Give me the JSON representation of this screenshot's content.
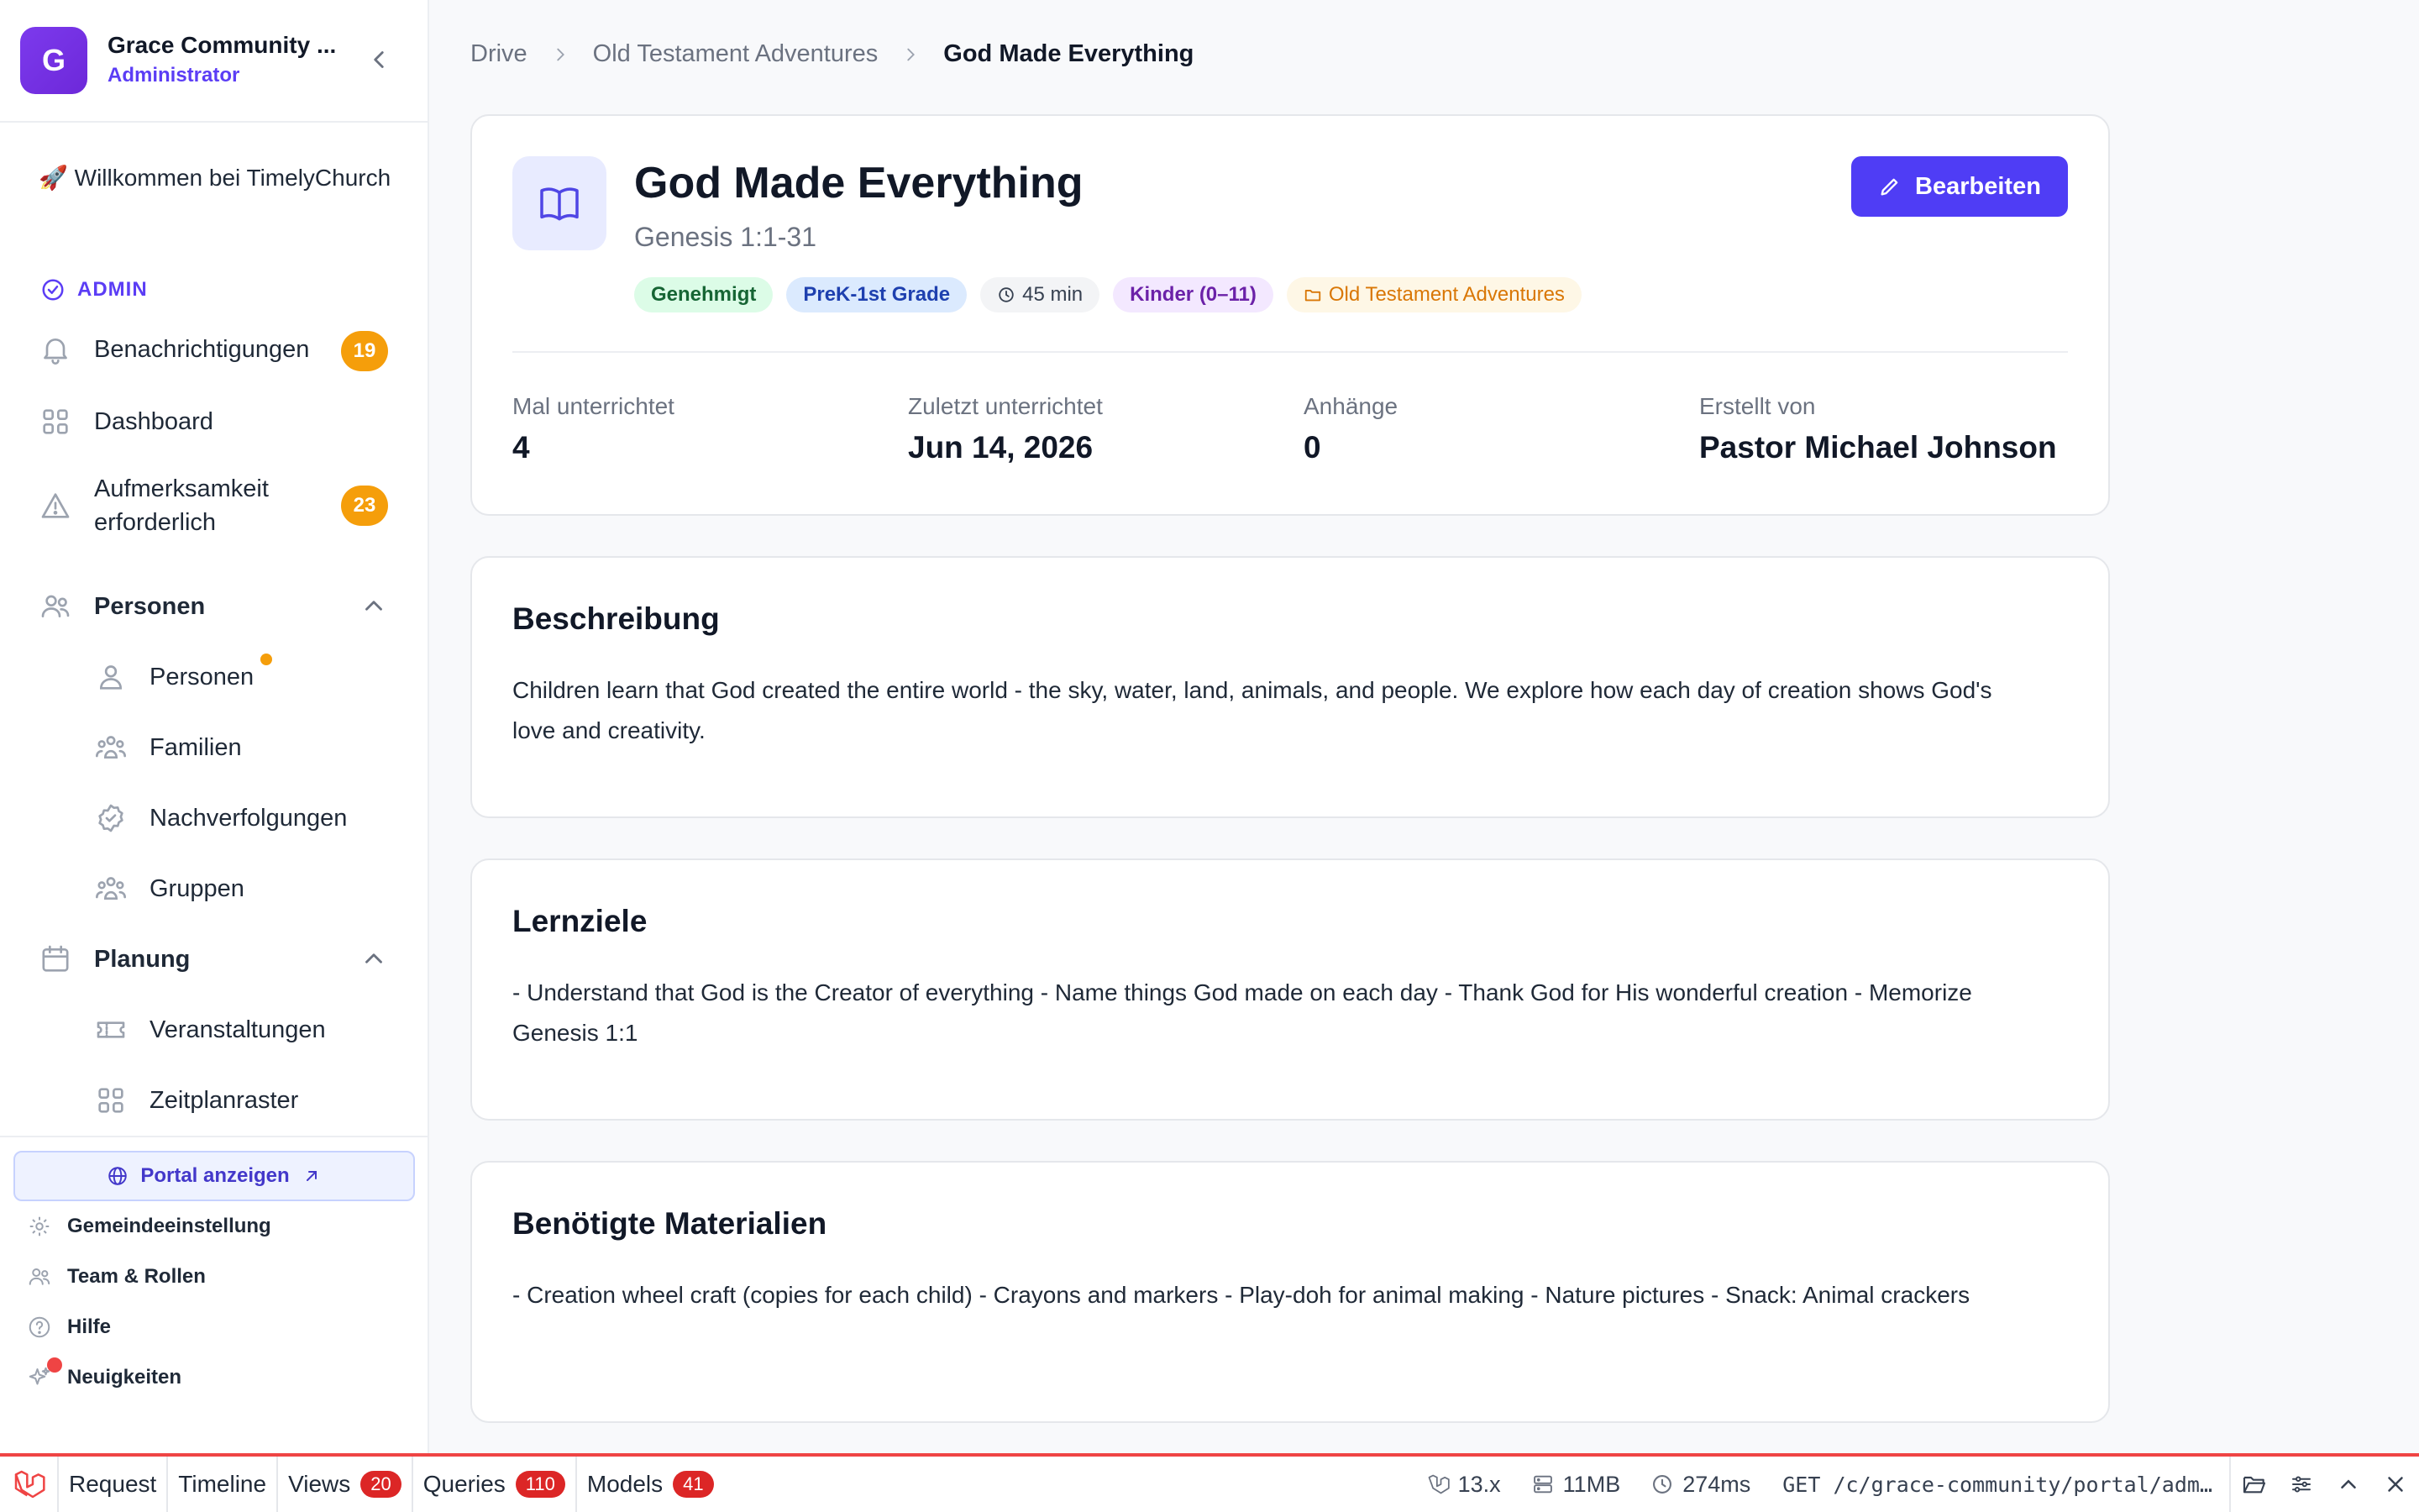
{
  "sidebar": {
    "org_initial": "G",
    "org_name": "Grace Community ...",
    "org_role": "Administrator",
    "welcome": "🚀 Willkommen bei TimelyChurch",
    "section_admin": "ADMIN",
    "items": {
      "notifications": {
        "label": "Benachrichtigungen",
        "badge": "19"
      },
      "dashboard": {
        "label": "Dashboard"
      },
      "attention": {
        "label_line1": "Aufmerksamkeit",
        "label_line2": "erforderlich",
        "badge": "23"
      },
      "people_group": {
        "label": "Personen"
      },
      "people": {
        "label": "Personen"
      },
      "families": {
        "label": "Familien"
      },
      "followups": {
        "label": "Nachverfolgungen"
      },
      "groups": {
        "label": "Gruppen"
      },
      "planning_group": {
        "label": "Planung"
      },
      "events": {
        "label": "Veranstaltungen"
      },
      "schedule": {
        "label": "Zeitplanraster"
      }
    },
    "portal_button": "Portal anzeigen",
    "footer": {
      "settings": "Gemeindeeinstellung",
      "team": "Team & Rollen",
      "help": "Hilfe",
      "news": "Neuigkeiten"
    }
  },
  "breadcrumb": {
    "root": "Drive",
    "parent": "Old Testament Adventures",
    "current": "God Made Everything"
  },
  "lesson": {
    "title": "God Made Everything",
    "subtitle": "Genesis 1:1-31",
    "tags": {
      "status": "Genehmigt",
      "grade": "PreK-1st Grade",
      "duration": "45 min",
      "age": "Kinder (0–11)",
      "series": "Old Testament Adventures"
    },
    "edit_button": "Bearbeiten",
    "stats": {
      "taught_label": "Mal unterrichtet",
      "taught_value": "4",
      "last_label": "Zuletzt unterrichtet",
      "last_value": "Jun 14, 2026",
      "attachments_label": "Anhänge",
      "attachments_value": "0",
      "author_label": "Erstellt von",
      "author_value": "Pastor Michael Johnson"
    }
  },
  "sections": {
    "description": {
      "title": "Beschreibung",
      "body": "Children learn that God created the entire world - the sky, water, land, animals, and people. We explore how each day of creation shows God's love and creativity."
    },
    "goals": {
      "title": "Lernziele",
      "body": "- Understand that God is the Creator of everything - Name things God made on each day - Thank God for His wonderful creation - Memorize Genesis 1:1"
    },
    "materials": {
      "title": "Benötigte Materialien",
      "body": "- Creation wheel craft (copies for each child) - Crayons and markers - Play-doh for animal making - Nature pictures - Snack: Animal crackers"
    }
  },
  "debugbar": {
    "tabs": {
      "request": "Request",
      "timeline": "Timeline",
      "views": "Views",
      "views_count": "20",
      "queries": "Queries",
      "queries_count": "110",
      "models": "Models",
      "models_count": "41"
    },
    "version": "13.x",
    "memory": "11MB",
    "time": "274ms",
    "route": "GET /c/grace-community/portal/adm…"
  },
  "colors": {
    "accent": "#4f3df5",
    "badge": "#f59e0b",
    "debug_red": "#ef4444"
  }
}
